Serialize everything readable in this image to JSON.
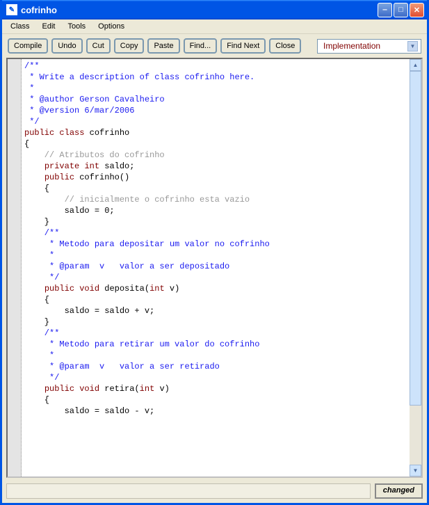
{
  "window": {
    "title": "cofrinho"
  },
  "menu": {
    "items": [
      "Class",
      "Edit",
      "Tools",
      "Options"
    ]
  },
  "toolbar": {
    "buttons": [
      "Compile",
      "Undo",
      "Cut",
      "Copy",
      "Paste",
      "Find...",
      "Find Next",
      "Close"
    ],
    "dropdown": {
      "selected": "Implementation"
    }
  },
  "code_lines": [
    {
      "cls": "c-doc",
      "text": "/**"
    },
    {
      "cls": "c-doc",
      "text": " * Write a description of class cofrinho here."
    },
    {
      "cls": "c-doc",
      "text": " * "
    },
    {
      "cls": "c-doc",
      "text": " * @author Gerson Cavalheiro "
    },
    {
      "cls": "c-doc",
      "text": " * @version 6/mar/2006"
    },
    {
      "cls": "c-doc",
      "text": " */"
    },
    {
      "cls": "mixed",
      "segments": [
        [
          "kw",
          "public"
        ],
        [
          "sp",
          " "
        ],
        [
          "kw",
          "class"
        ],
        [
          "sp",
          " "
        ],
        [
          "txt",
          "cofrinho"
        ]
      ]
    },
    {
      "cls": "txt",
      "text": "{"
    },
    {
      "cls": "c-comment",
      "text": "    // Atributos do cofrinho"
    },
    {
      "cls": "mixed",
      "segments": [
        [
          "sp",
          "    "
        ],
        [
          "kw",
          "private"
        ],
        [
          "sp",
          " "
        ],
        [
          "type",
          "int"
        ],
        [
          "sp",
          " "
        ],
        [
          "txt",
          "saldo;"
        ]
      ]
    },
    {
      "cls": "txt",
      "text": ""
    },
    {
      "cls": "mixed",
      "segments": [
        [
          "sp",
          "    "
        ],
        [
          "kw",
          "public"
        ],
        [
          "sp",
          " "
        ],
        [
          "txt",
          "cofrinho()"
        ]
      ]
    },
    {
      "cls": "txt",
      "text": "    {"
    },
    {
      "cls": "c-comment",
      "text": "        // inicialmente o cofrinho esta vazio"
    },
    {
      "cls": "txt",
      "text": "        saldo = 0;"
    },
    {
      "cls": "txt",
      "text": "    }"
    },
    {
      "cls": "txt",
      "text": ""
    },
    {
      "cls": "c-doc",
      "text": "    /**"
    },
    {
      "cls": "c-doc",
      "text": "     * Metodo para depositar um valor no cofrinho"
    },
    {
      "cls": "c-doc",
      "text": "     * "
    },
    {
      "cls": "c-doc",
      "text": "     * @param  v   valor a ser depositado"
    },
    {
      "cls": "c-doc",
      "text": "     */"
    },
    {
      "cls": "mixed",
      "segments": [
        [
          "sp",
          "    "
        ],
        [
          "kw",
          "public"
        ],
        [
          "sp",
          " "
        ],
        [
          "type",
          "void"
        ],
        [
          "sp",
          " "
        ],
        [
          "txt",
          "deposita("
        ],
        [
          "type",
          "int"
        ],
        [
          "sp",
          " "
        ],
        [
          "txt",
          "v)"
        ]
      ]
    },
    {
      "cls": "txt",
      "text": "    {"
    },
    {
      "cls": "txt",
      "text": "        saldo = saldo + v;"
    },
    {
      "cls": "txt",
      "text": "    }"
    },
    {
      "cls": "txt",
      "text": ""
    },
    {
      "cls": "c-doc",
      "text": "    /**"
    },
    {
      "cls": "c-doc",
      "text": "     * Metodo para retirar um valor do cofrinho"
    },
    {
      "cls": "c-doc",
      "text": "     * "
    },
    {
      "cls": "c-doc",
      "text": "     * @param  v   valor a ser retirado"
    },
    {
      "cls": "c-doc",
      "text": "     */"
    },
    {
      "cls": "mixed",
      "segments": [
        [
          "sp",
          "    "
        ],
        [
          "kw",
          "public"
        ],
        [
          "sp",
          " "
        ],
        [
          "type",
          "void"
        ],
        [
          "sp",
          " "
        ],
        [
          "txt",
          "retira("
        ],
        [
          "type",
          "int"
        ],
        [
          "sp",
          " "
        ],
        [
          "txt",
          "v)"
        ]
      ]
    },
    {
      "cls": "txt",
      "text": "    {"
    },
    {
      "cls": "txt",
      "text": "        saldo = saldo - v;"
    }
  ],
  "status": {
    "label": "changed"
  }
}
